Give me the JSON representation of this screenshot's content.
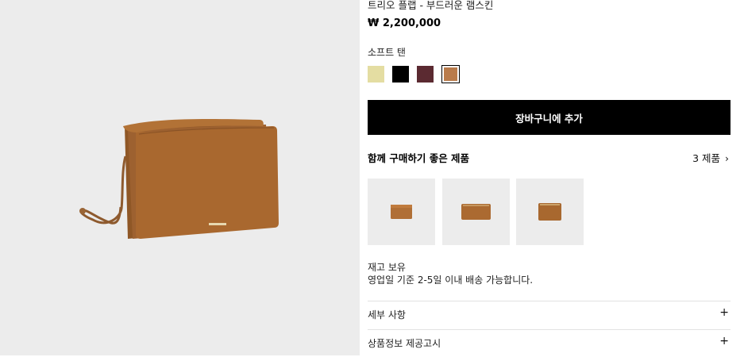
{
  "product": {
    "title": "트리오 플랩 - 부드러운 램스킨",
    "price": "₩ 2,200,000",
    "color_label": "소프트 탠",
    "swatches": [
      {
        "name": "yellow",
        "color": "#e4dda2"
      },
      {
        "name": "black",
        "color": "#000000"
      },
      {
        "name": "burgundy",
        "color": "#5b2a31"
      },
      {
        "name": "soft-tan",
        "color": "#b97b4b",
        "selected": true
      }
    ],
    "add_to_cart": "장바구니에 추가"
  },
  "recommend": {
    "title": "함께 구매하기 좋은 제품",
    "count": "3 제품",
    "chevron": "›",
    "items": [
      {
        "icon": "card-holder-thumbnail"
      },
      {
        "icon": "zip-wallet-thumbnail"
      },
      {
        "icon": "coin-pouch-thumbnail"
      }
    ]
  },
  "availability": {
    "stock": "재고 보유",
    "shipping": "영업일 기준 2-5일 이내 배송 가능합니다."
  },
  "accordions": [
    {
      "label": "세부 사항",
      "icon": "+"
    },
    {
      "label": "상품정보 제공고시",
      "icon": "+"
    }
  ]
}
